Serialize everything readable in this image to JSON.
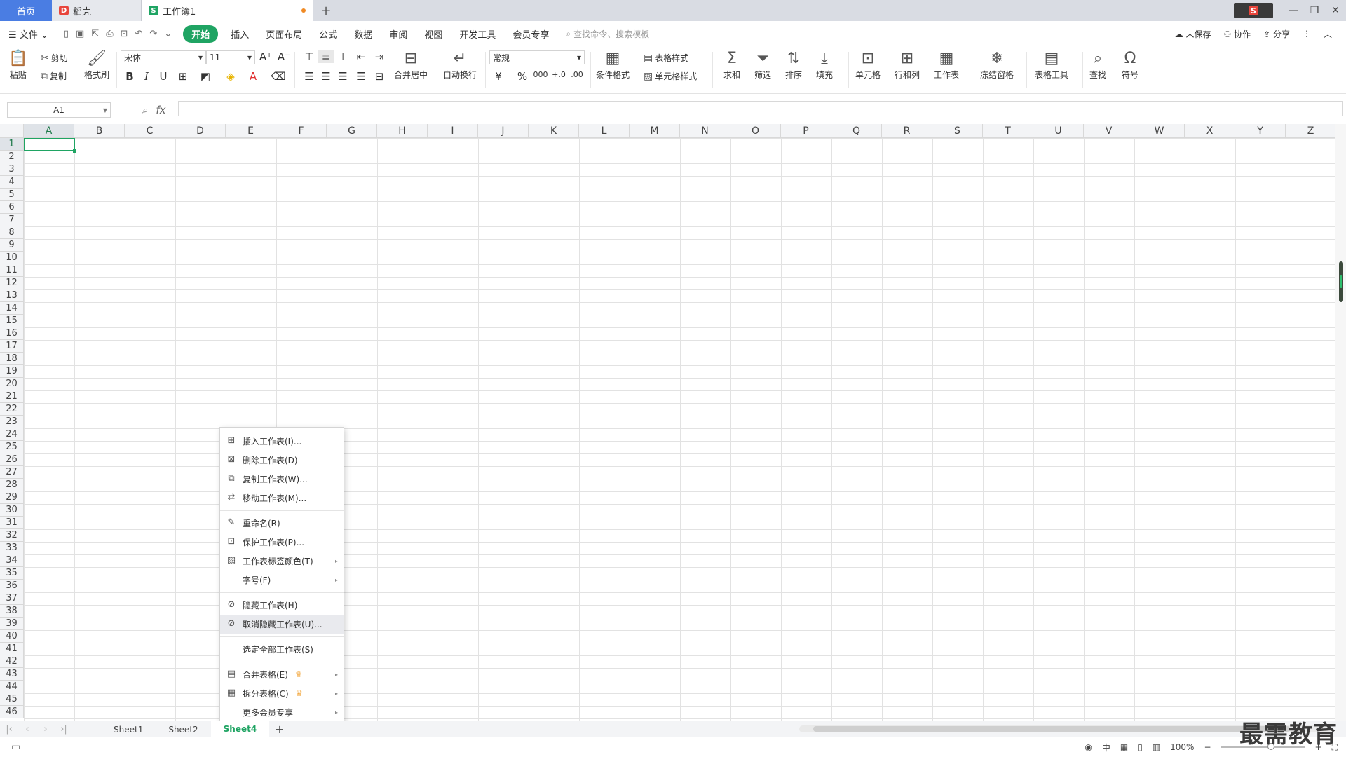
{
  "tabs": {
    "home": "首页",
    "daoke": "稻壳",
    "doc": "工作簿1",
    "doc_badge": "S",
    "daoke_badge": "D",
    "add": "+"
  },
  "window": {
    "minimize": "—",
    "restore": "❐",
    "close": "✕",
    "logo": "S"
  },
  "menu": {
    "file": "文件",
    "items": [
      "开始",
      "插入",
      "页面布局",
      "公式",
      "数据",
      "审阅",
      "视图",
      "开发工具",
      "会员专享"
    ],
    "active_index": 0,
    "search_placeholder": "查找命令、搜索模板",
    "right": {
      "unsaved": "未保存",
      "collab": "协作",
      "share": "分享"
    }
  },
  "ribbon": {
    "paste": "粘贴",
    "cut": "剪切",
    "copy": "复制",
    "format_painter": "格式刷",
    "font_name": "宋体",
    "font_size": "11",
    "merge_center": "合并居中",
    "wrap_text": "自动换行",
    "number_format": "常规",
    "cond_format": "条件格式",
    "table_style": "表格样式",
    "cell_style": "单元格样式",
    "sum": "求和",
    "filter": "筛选",
    "sort": "排序",
    "fill": "填充",
    "cell": "单元格",
    "row_col": "行和列",
    "worksheet": "工作表",
    "freeze": "冻结窗格",
    "table_tools": "表格工具",
    "find": "查找",
    "symbol": "符号"
  },
  "formula": {
    "name_box": "A1",
    "fx": "fx"
  },
  "grid": {
    "columns": [
      "A",
      "B",
      "C",
      "D",
      "E",
      "F",
      "G",
      "H",
      "I",
      "J",
      "K",
      "L",
      "M",
      "N",
      "O",
      "P",
      "Q",
      "R",
      "S",
      "T",
      "U",
      "V",
      "W",
      "X",
      "Y",
      "Z"
    ],
    "rows": [
      "1",
      "2",
      "3",
      "4",
      "5",
      "6",
      "7",
      "8",
      "9",
      "10",
      "11",
      "12",
      "13",
      "14",
      "15",
      "16",
      "17",
      "18",
      "19",
      "20",
      "21",
      "22",
      "23",
      "24",
      "25",
      "26",
      "27",
      "28",
      "29",
      "30",
      "31",
      "32",
      "33",
      "34",
      "35",
      "36",
      "37",
      "38",
      "39",
      "40",
      "41",
      "42",
      "43",
      "44",
      "45",
      "46"
    ],
    "active_cell": "A1"
  },
  "context_menu": [
    {
      "label": "插入工作表(I)...",
      "icon": "insert-sheet-icon"
    },
    {
      "label": "删除工作表(D)",
      "icon": "delete-sheet-icon"
    },
    {
      "label": "复制工作表(W)...",
      "icon": "copy-sheet-icon"
    },
    {
      "label": "移动工作表(M)...",
      "icon": "move-sheet-icon",
      "sep_after": true
    },
    {
      "label": "重命名(R)",
      "icon": "rename-icon"
    },
    {
      "label": "保护工作表(P)...",
      "icon": "protect-sheet-icon"
    },
    {
      "label": "工作表标签颜色(T)",
      "icon": "tab-color-icon",
      "submenu": true
    },
    {
      "label": "字号(F)",
      "icon": "",
      "submenu": true,
      "sep_after": true
    },
    {
      "label": "隐藏工作表(H)",
      "icon": "hide-sheet-icon"
    },
    {
      "label": "取消隐藏工作表(U)...",
      "icon": "unhide-sheet-icon",
      "hover": true,
      "sep_after": true
    },
    {
      "label": "选定全部工作表(S)",
      "icon": "",
      "sep_after": true
    },
    {
      "label": "合并表格(E)",
      "icon": "merge-table-icon",
      "crown": true,
      "submenu": true
    },
    {
      "label": "拆分表格(C)",
      "icon": "split-table-icon",
      "crown": true,
      "submenu": true
    },
    {
      "label": "更多会员专享",
      "icon": "",
      "submenu": true
    }
  ],
  "sheets": {
    "tabs": [
      "Sheet1",
      "Sheet2",
      "Sheet4"
    ],
    "active_index": 2,
    "add": "+"
  },
  "status": {
    "zoom": "100%"
  },
  "watermark": "最需教育",
  "colors": {
    "accent": "#1fa463",
    "home_tab": "#4a7de3"
  }
}
